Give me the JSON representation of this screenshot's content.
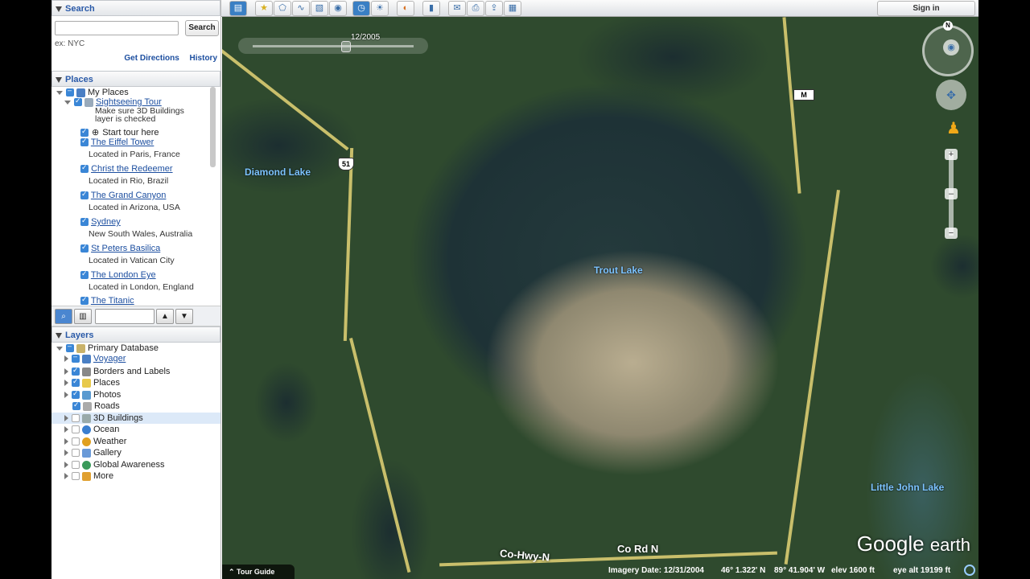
{
  "search": {
    "title": "Search",
    "button": "Search",
    "hint": "ex: NYC",
    "get_directions": "Get Directions",
    "history": "History"
  },
  "places": {
    "title": "Places",
    "my_places": "My Places",
    "tour": {
      "name": "Sightseeing Tour",
      "note_line1": "Make sure 3D Buildings",
      "note_line2": "layer is checked",
      "start": "Start tour here"
    },
    "items": [
      {
        "name": "The Eiffel Tower",
        "desc": "Located in Paris, France"
      },
      {
        "name": "Christ the Redeemer",
        "desc": "Located in Rio, Brazil"
      },
      {
        "name": "The Grand Canyon",
        "desc": "Located in Arizona, USA"
      },
      {
        "name": "Sydney",
        "desc": "New South Wales, Australia"
      },
      {
        "name": "St Peters Basilica",
        "desc": "Located in Vatican City"
      },
      {
        "name": "The London Eye",
        "desc": "Located in London, England"
      },
      {
        "name": "The Titanic",
        "desc": ""
      }
    ]
  },
  "layers": {
    "title": "Layers",
    "primary": "Primary Database",
    "items": [
      {
        "label": "Voyager",
        "state": "part",
        "link": true
      },
      {
        "label": "Borders and Labels",
        "state": "on"
      },
      {
        "label": "Places",
        "state": "on"
      },
      {
        "label": "Photos",
        "state": "on"
      },
      {
        "label": "Roads",
        "state": "on"
      },
      {
        "label": "3D Buildings",
        "state": "off"
      },
      {
        "label": "Ocean",
        "state": "off"
      },
      {
        "label": "Weather",
        "state": "off"
      },
      {
        "label": "Gallery",
        "state": "off"
      },
      {
        "label": "Global Awareness",
        "state": "off"
      },
      {
        "label": "More",
        "state": "off"
      }
    ]
  },
  "toolbar": {
    "sign_in": "Sign in"
  },
  "map": {
    "time_slider_date": "12/2005",
    "labels": {
      "diamond_lake": "Diamond Lake",
      "trout_lake": "Trout Lake",
      "little_john_lake": "Little John Lake",
      "co_hwy_n": "Co-Hwy-N",
      "co_rd_n": "Co Rd N"
    },
    "shields": {
      "route51": "51",
      "route_m": "M"
    },
    "nav_north": "N",
    "logo_google": "Google",
    "logo_earth": "earth"
  },
  "status": {
    "tour_guide": "Tour Guide",
    "imagery_date": "Imagery Date: 12/31/2004",
    "lat": "46° 1.322' N",
    "lon": "89° 41.904' W",
    "elev": "elev  1600 ft",
    "eye_alt": "eye alt  19199 ft"
  }
}
